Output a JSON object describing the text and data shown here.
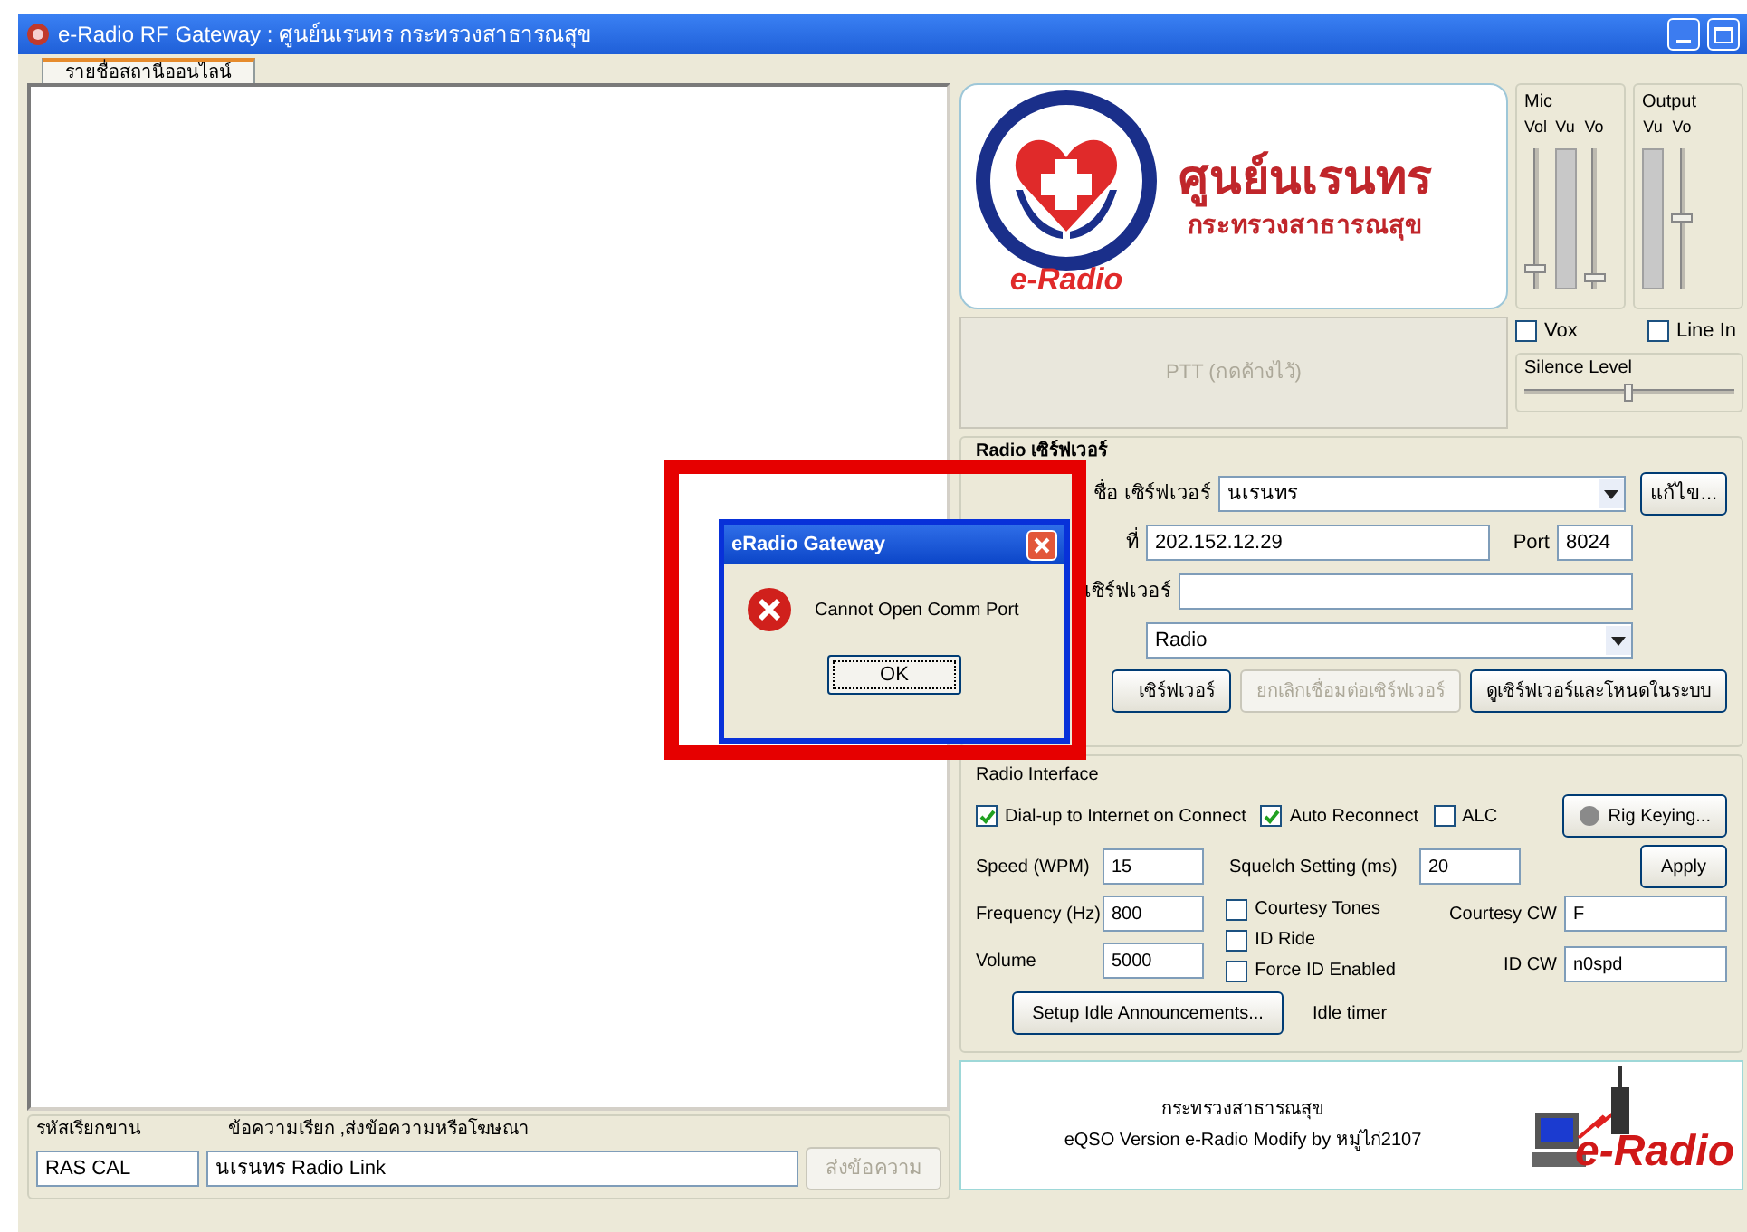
{
  "window": {
    "title": "e-Radio RF Gateway : ศูนย์นเรนทร  กระทรวงสาธารณสุข"
  },
  "tabs": [
    {
      "label": "รายชื่อสถานีออนไลน์",
      "selected": true
    }
  ],
  "message_bar": {
    "callsign_label": "รหัสเรียกขาน",
    "message_label": "ข้อความเรียก ,ส่งข้อความหรือโฆษณา",
    "callsign": "RAS CAL",
    "message": "นเรนทร Radio Link",
    "send_button": {
      "label": "ส่งข้อความ",
      "disabled": true
    }
  },
  "logo": {
    "title": "ศูนย์นเรนทร",
    "subtitle": "กระทรวงสาธารณสุข",
    "brand": "e-Radio"
  },
  "mixer": [
    {
      "label": "Mic",
      "columns": [
        {
          "label": "Vol",
          "kind": "slider",
          "level": 0.12
        },
        {
          "label": "Vu",
          "kind": "meter"
        },
        {
          "label": "Vo",
          "kind": "slider",
          "level": 0.05
        }
      ]
    },
    {
      "label": "Output",
      "columns": [
        {
          "label": "Vu",
          "kind": "meter"
        },
        {
          "label": "Vo",
          "kind": "slider",
          "level": 0.5
        }
      ]
    }
  ],
  "ptt": {
    "label": "PTT (กดค้างไว้)",
    "disabled": true
  },
  "audio": {
    "options": [
      {
        "label": "Vox",
        "checked": false
      },
      {
        "label": "Line In",
        "checked": false
      }
    ],
    "silence": {
      "label": "Silence Level",
      "level": 0.5
    }
  },
  "server": {
    "title": "Radio เซิร์ฟเวอร์",
    "name_label": "ชื่อ เซิร์ฟเวอร์",
    "name": "นเรนทร",
    "edit_button": "แก้ไข...",
    "ip_label": "ที่",
    "ip": "202.152.12.29",
    "port_label": "Port",
    "port": "8024",
    "password_label": "เซิร์ฟเวอร์",
    "room": "Radio",
    "buttons": [
      {
        "label": "เซิร์ฟเวอร์",
        "disabled": false
      },
      {
        "label": "ยกเลิกเชื่อมต่อเซิร์ฟเวอร์",
        "disabled": true
      },
      {
        "label": "ดูเซิร์ฟเวอร์และโหนดในระบบ",
        "disabled": false
      }
    ]
  },
  "interface": {
    "title": "Radio Interface",
    "options": [
      {
        "label": "Dial-up to Internet on Connect",
        "checked": true
      },
      {
        "label": "Auto Reconnect",
        "checked": true
      },
      {
        "label": "ALC",
        "checked": false
      }
    ],
    "rig_button": "Rig Keying...",
    "fields": [
      {
        "label": "Speed (WPM)",
        "value": "15"
      },
      {
        "label": "Frequency (Hz)",
        "value": "800"
      },
      {
        "label": "Volume",
        "value": "5000"
      }
    ],
    "squelch": {
      "label": "Squelch Setting (ms)",
      "value": "20"
    },
    "apply": "Apply",
    "toggles": [
      {
        "label": "Courtesy Tones",
        "checked": false
      },
      {
        "label": "ID Ride",
        "checked": false
      },
      {
        "label": "Force ID Enabled",
        "checked": false
      }
    ],
    "cw": [
      {
        "label": "Courtesy CW",
        "value": "F"
      },
      {
        "label": "ID CW",
        "value": "n0spd"
      }
    ],
    "idle_button": "Setup Idle Announcements...",
    "idle_label": "Idle timer"
  },
  "footer": {
    "title": "กระทรวงสาธารณสุข",
    "credit": "eQSO Version e-Radio Modify by หมู่ไก่2107",
    "brand": "e-Radio"
  },
  "dialog": {
    "title": "eRadio Gateway",
    "message": "Cannot Open Comm Port",
    "button": "OK"
  }
}
